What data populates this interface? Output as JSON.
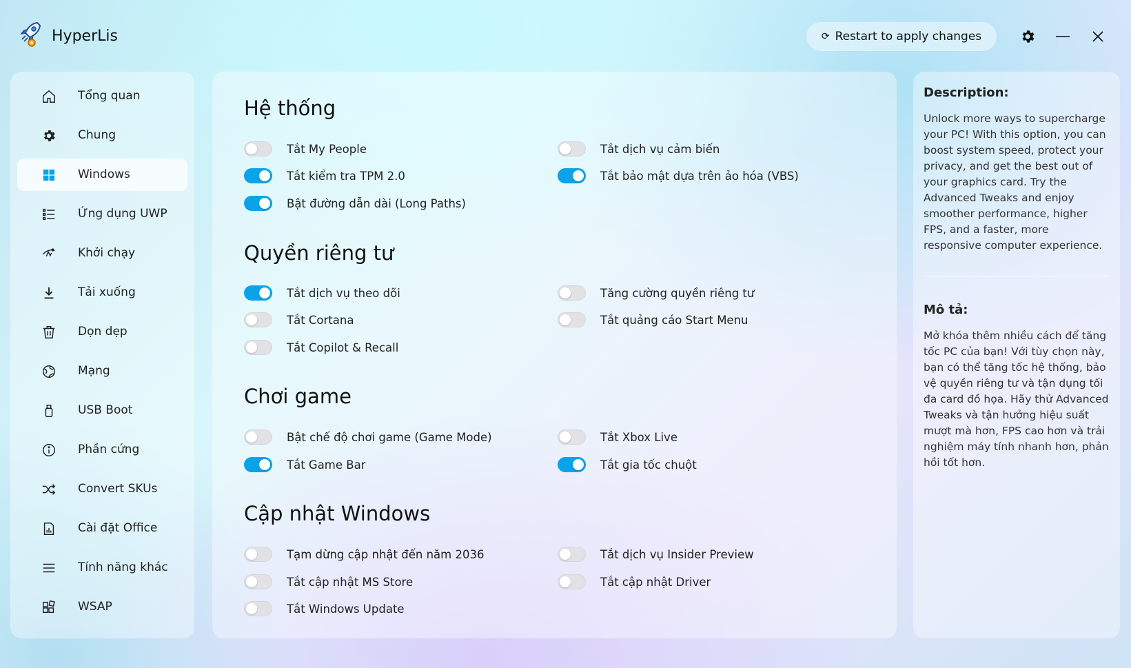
{
  "app": {
    "title": "HyperLis",
    "restart_label": "Restart to apply changes",
    "accent": "#0aa3e8"
  },
  "sidebar": {
    "items": [
      {
        "label": "Tổng quan",
        "icon": "home-icon",
        "active": false
      },
      {
        "label": "Chung",
        "icon": "gear-icon",
        "active": false
      },
      {
        "label": "Windows",
        "icon": "windows-icon",
        "active": true
      },
      {
        "label": "Ứng dụng UWP",
        "icon": "list-icon",
        "active": false
      },
      {
        "label": "Khởi chạy",
        "icon": "startup-icon",
        "active": false
      },
      {
        "label": "Tải xuống",
        "icon": "download-icon",
        "active": false
      },
      {
        "label": "Dọn dẹp",
        "icon": "trash-icon",
        "active": false
      },
      {
        "label": "Mạng",
        "icon": "globe-icon",
        "active": false
      },
      {
        "label": "USB Boot",
        "icon": "usb-icon",
        "active": false
      },
      {
        "label": "Phần cứng",
        "icon": "info-icon",
        "active": false
      },
      {
        "label": "Convert SKUs",
        "icon": "shuffle-icon",
        "active": false
      },
      {
        "label": "Cài đặt Office",
        "icon": "office-icon",
        "active": false
      },
      {
        "label": "Tính năng khác",
        "icon": "menu-icon",
        "active": false
      },
      {
        "label": "WSAP",
        "icon": "apps-icon",
        "active": false
      }
    ]
  },
  "sections": [
    {
      "title": "Hệ thống",
      "left": [
        {
          "label": "Tắt My People",
          "on": false
        },
        {
          "label": "Tắt kiểm tra TPM 2.0",
          "on": true
        },
        {
          "label": "Bật đường dẫn dài (Long Paths)",
          "on": true
        }
      ],
      "right": [
        {
          "label": "Tắt dịch vụ cảm biến",
          "on": false
        },
        {
          "label": "Tắt bảo mật dựa trên ảo hóa (VBS)",
          "on": true
        }
      ]
    },
    {
      "title": "Quyền riêng tư",
      "left": [
        {
          "label": "Tắt dịch vụ theo dõi",
          "on": true
        },
        {
          "label": "Tắt Cortana",
          "on": false
        },
        {
          "label": "Tắt Copilot & Recall",
          "on": false
        }
      ],
      "right": [
        {
          "label": "Tăng cường quyền riêng tư",
          "on": false
        },
        {
          "label": "Tắt quảng cáo Start Menu",
          "on": false
        }
      ]
    },
    {
      "title": "Chơi game",
      "left": [
        {
          "label": "Bật chế độ chơi game (Game Mode)",
          "on": false
        },
        {
          "label": "Tắt Game Bar",
          "on": true
        }
      ],
      "right": [
        {
          "label": "Tắt Xbox Live",
          "on": false
        },
        {
          "label": "Tắt gia tốc chuột",
          "on": true
        }
      ]
    },
    {
      "title": "Cập nhật Windows",
      "left": [
        {
          "label": "Tạm dừng cập nhật đến năm 2036",
          "on": false
        },
        {
          "label": "Tắt cập nhật MS Store",
          "on": false
        },
        {
          "label": "Tắt Windows Update",
          "on": false
        }
      ],
      "right": [
        {
          "label": "Tắt dịch vụ Insider Preview",
          "on": false
        },
        {
          "label": "Tắt cập nhật Driver",
          "on": false
        }
      ]
    }
  ],
  "description": {
    "en_heading": "Description:",
    "en_text": "Unlock more ways to supercharge your PC! With this option, you can boost system speed, protect your privacy, and get the best out of your graphics card. Try the Advanced Tweaks and enjoy smoother performance, higher FPS, and a faster, more responsive computer experience.",
    "vi_heading": "Mô tả:",
    "vi_text": "Mở khóa thêm nhiều cách để tăng tốc PC của bạn! Với tùy chọn này, bạn có thể tăng tốc hệ thống, bảo vệ quyền riêng tư và tận dụng tối đa card đồ họa. Hãy thử Advanced Tweaks và tận hưởng hiệu suất mượt mà hơn, FPS cao hơn và trải nghiệm máy tính nhanh hơn, phản hồi tốt hơn."
  }
}
